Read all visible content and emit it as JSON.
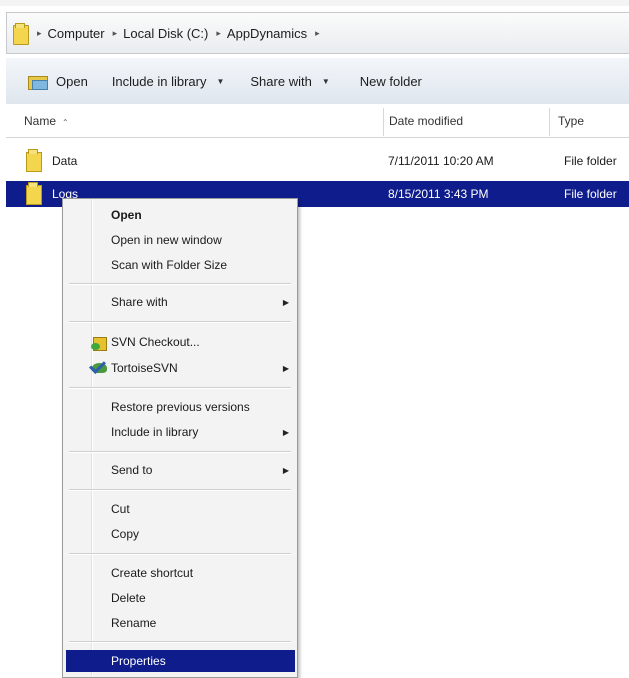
{
  "address_bar": {
    "crumbs": [
      "Computer",
      "Local Disk (C:)",
      "AppDynamics"
    ]
  },
  "toolbar": {
    "open_label": "Open",
    "include_label": "Include in library",
    "share_label": "Share with",
    "new_folder_label": "New folder"
  },
  "columns": {
    "name": "Name",
    "date": "Date modified",
    "type": "Type"
  },
  "files": [
    {
      "name": "Data",
      "date": "7/11/2011 10:20 AM",
      "type": "File folder",
      "selected": false
    },
    {
      "name": "Logs",
      "date": "8/15/2011 3:43 PM",
      "type": "File folder",
      "selected": true
    }
  ],
  "context_menu": {
    "open": "Open",
    "open_new_window": "Open in new window",
    "scan_folder_size": "Scan with Folder Size",
    "share_with": "Share with",
    "svn_checkout": "SVN Checkout...",
    "tortoise_svn": "TortoiseSVN",
    "restore_versions": "Restore previous versions",
    "include_library": "Include in library",
    "send_to": "Send to",
    "cut": "Cut",
    "copy": "Copy",
    "create_shortcut": "Create shortcut",
    "delete": "Delete",
    "rename": "Rename",
    "properties": "Properties"
  },
  "colors": {
    "selection": "#0f1d8c",
    "folder": "#f4d64e"
  }
}
